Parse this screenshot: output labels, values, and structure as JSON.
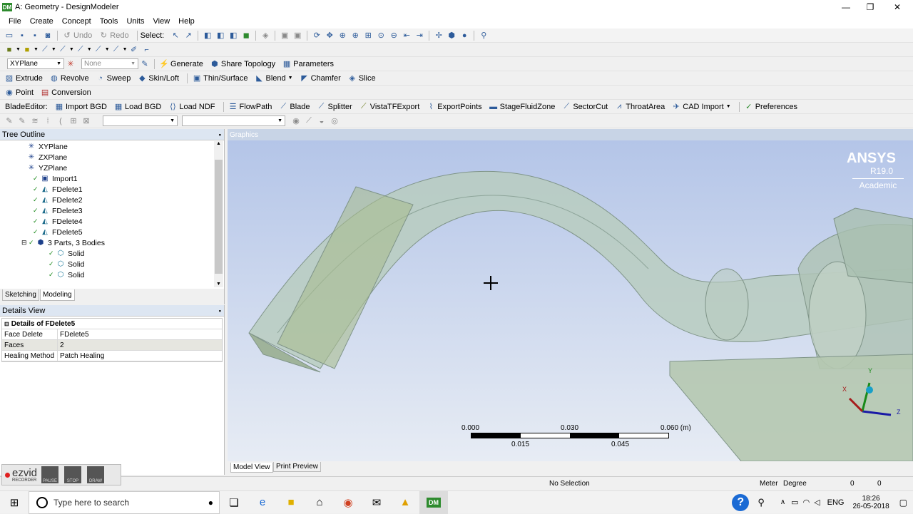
{
  "window": {
    "app_badge": "DM",
    "title": "A: Geometry - DesignModeler",
    "minimize": "—",
    "maximize": "❐",
    "close": "✕"
  },
  "menu": [
    "File",
    "Create",
    "Concept",
    "Tools",
    "Units",
    "View",
    "Help"
  ],
  "toolbar1": {
    "undo": "Undo",
    "redo": "Redo",
    "select": "Select:"
  },
  "toolbar3": {
    "plane": "XYPlane",
    "sketch": "None",
    "generate": "Generate",
    "share_topology": "Share Topology",
    "parameters": "Parameters"
  },
  "toolbar4": [
    "Extrude",
    "Revolve",
    "Sweep",
    "Skin/Loft",
    "Thin/Surface",
    "Blend",
    "Chamfer",
    "Slice"
  ],
  "toolbar5": [
    "Point",
    "Conversion"
  ],
  "toolbar6": {
    "label": "BladeEditor:",
    "items": [
      "Import BGD",
      "Load BGD",
      "Load NDF",
      "FlowPath",
      "Blade",
      "Splitter",
      "VistaTFExport",
      "ExportPoints",
      "StageFluidZone",
      "SectorCut",
      "ThroatArea",
      "CAD Import",
      "Preferences"
    ]
  },
  "tree": {
    "header": "Tree Outline",
    "items": [
      "XYPlane",
      "ZXPlane",
      "YZPlane",
      "Import1",
      "FDelete1",
      "FDelete2",
      "FDelete3",
      "FDelete4",
      "FDelete5",
      "3 Parts, 3 Bodies",
      "Solid",
      "Solid",
      "Solid"
    ]
  },
  "tabs": {
    "sketching": "Sketching",
    "modeling": "Modeling"
  },
  "details": {
    "header": "Details View",
    "title": "Details of FDelete5",
    "rows": [
      {
        "k": "Face Delete",
        "v": "FDelete5"
      },
      {
        "k": "Faces",
        "v": "2"
      },
      {
        "k": "Healing Method",
        "v": "Patch Healing"
      }
    ]
  },
  "graphics": {
    "header": "Graphics",
    "brand": "ANSYS",
    "version": "R19.0",
    "edition": "Academic",
    "scale": [
      "0.000",
      "0.030",
      "0.060 (m)",
      "0.015",
      "0.045"
    ],
    "axes": [
      "X",
      "Y",
      "Z"
    ]
  },
  "bottom_tabs": {
    "model_view": "Model View",
    "print_preview": "Print Preview"
  },
  "status": {
    "selection": "No Selection",
    "unit": "Meter",
    "angle": "Degree",
    "v1": "0",
    "v2": "0"
  },
  "recorder": {
    "brand": "ezvid",
    "sub": "RECORDER",
    "pause": "PAUSE",
    "stop": "STOP",
    "draw": "DRAW"
  },
  "taskbar": {
    "search": "Type here to search",
    "help": "?",
    "lang": "ENG",
    "time": "18:26",
    "date": "26-05-2018"
  },
  "colors": {
    "viewport_top": "#b4c5e8",
    "viewport_bottom": "#e7ecf4",
    "pipe": "#b9ccc0",
    "accent": "#2e8b2e"
  }
}
